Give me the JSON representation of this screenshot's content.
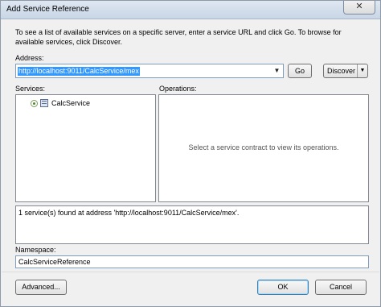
{
  "window": {
    "title": "Add Service Reference",
    "close_glyph": "✕"
  },
  "description": "To see a list of available services on a specific server, enter a service URL and click Go. To browse for available services, click Discover.",
  "address": {
    "label": "Address:",
    "value": "http://localhost:9011/CalcService/mex",
    "dropdown_glyph": "▼"
  },
  "buttons": {
    "go": "Go",
    "discover": "Discover",
    "discover_arrow": "▼",
    "advanced": "Advanced...",
    "ok": "OK",
    "cancel": "Cancel"
  },
  "services": {
    "label": "Services:",
    "items": [
      {
        "label": "CalcService",
        "icon": "service-icon",
        "expanded": false
      }
    ]
  },
  "operations": {
    "label": "Operations:",
    "empty_message": "Select a service contract to view its operations."
  },
  "status": "1 service(s) found at address 'http://localhost:9011/CalcService/mex'.",
  "namespace": {
    "label": "Namespace:",
    "value": "CalcServiceReference"
  },
  "colors": {
    "selection": "#3399ff",
    "titlebar": "#c9d6e6"
  }
}
